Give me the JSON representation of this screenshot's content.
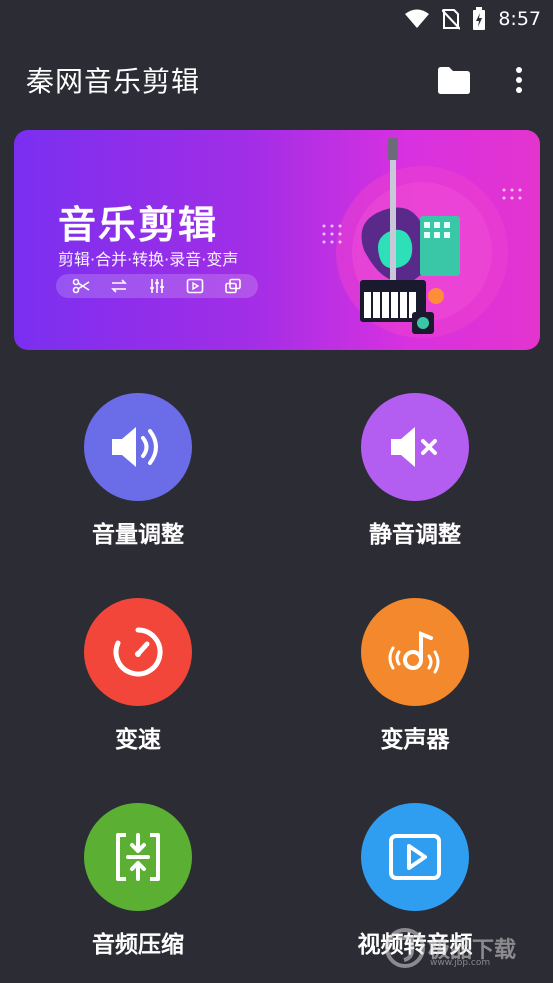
{
  "status_bar": {
    "time": "8:57",
    "icons": [
      "wifi-icon",
      "no-sim-icon",
      "battery-charging-icon"
    ]
  },
  "app_bar": {
    "title": "秦网音乐剪辑",
    "actions": [
      "folder-icon",
      "more-vert-icon"
    ]
  },
  "banner": {
    "title": "音乐剪辑",
    "subtitle": "剪辑·合并·转换·录音·变声",
    "toolbar_icons": [
      "scissors-icon",
      "swap-icon",
      "equalizer-icon",
      "play-box-icon",
      "copy-icon"
    ],
    "colors": {
      "start": "#7a2ff0",
      "end": "#e434cf"
    }
  },
  "features": [
    {
      "label": "音量调整",
      "icon": "volume-up-icon",
      "color": "#6b6de8"
    },
    {
      "label": "静音调整",
      "icon": "volume-mute-icon",
      "color": "#b35ef0"
    },
    {
      "label": "变速",
      "icon": "speedometer-icon",
      "color": "#f2463a"
    },
    {
      "label": "变声器",
      "icon": "voice-changer-icon",
      "color": "#f4882c"
    },
    {
      "label": "音频压缩",
      "icon": "compress-icon",
      "color": "#5bb033"
    },
    {
      "label": "视频转音频",
      "icon": "video-to-audio-icon",
      "color": "#2f9ef0"
    }
  ],
  "watermark": {
    "text": "极品下载",
    "url": "www.jbp.com"
  }
}
